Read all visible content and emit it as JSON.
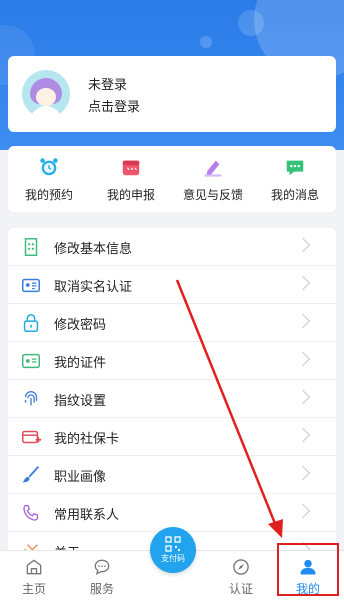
{
  "profile": {
    "name": "未登录",
    "login_prompt": "点击登录"
  },
  "shortcuts": [
    {
      "label": "我的预约",
      "icon": "alarm-clock-icon"
    },
    {
      "label": "我的申报",
      "icon": "calendar-icon"
    },
    {
      "label": "意见与反馈",
      "icon": "edit-pencil-icon"
    },
    {
      "label": "我的消息",
      "icon": "chat-bubble-icon"
    }
  ],
  "menu": [
    {
      "label": "修改基本信息",
      "icon": "profile-info-icon"
    },
    {
      "label": "取消实名认证",
      "icon": "id-card-icon"
    },
    {
      "label": "修改密码",
      "icon": "lock-icon"
    },
    {
      "label": "我的证件",
      "icon": "document-icon"
    },
    {
      "label": "指纹设置",
      "icon": "fingerprint-icon"
    },
    {
      "label": "我的社保卡",
      "icon": "social-security-card-icon"
    },
    {
      "label": "职业画像",
      "icon": "paint-brush-icon"
    },
    {
      "label": "常用联系人",
      "icon": "phone-contact-icon"
    },
    {
      "label": "关于",
      "icon": "info-icon"
    }
  ],
  "tabbar": {
    "home": "主页",
    "service": "服务",
    "pay": "支付码",
    "auth": "认证",
    "mine": "我的"
  },
  "colors": {
    "accent": "#1f8bf3",
    "header": "#2b7be9",
    "annotation": "#e02020"
  }
}
